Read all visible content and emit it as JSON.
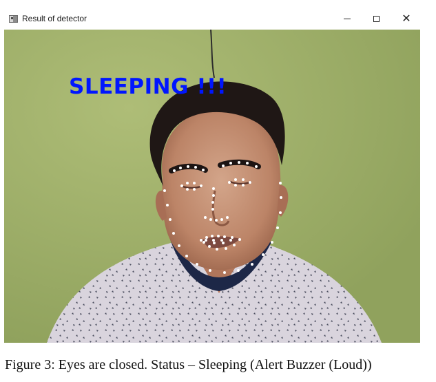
{
  "window": {
    "title": "Result of detector",
    "controls": {
      "minimize": "minimize-icon",
      "maximize": "maximize-icon",
      "close": "close-icon"
    }
  },
  "frame": {
    "status_text": "SLEEPING !!!",
    "status_color": "#0016ff",
    "background_color": "#9bac68",
    "landmark_color": "#ffffff"
  },
  "caption": {
    "text": "Figure 3: Eyes are closed. Status – Sleeping (Alert Buzzer (Loud))"
  }
}
